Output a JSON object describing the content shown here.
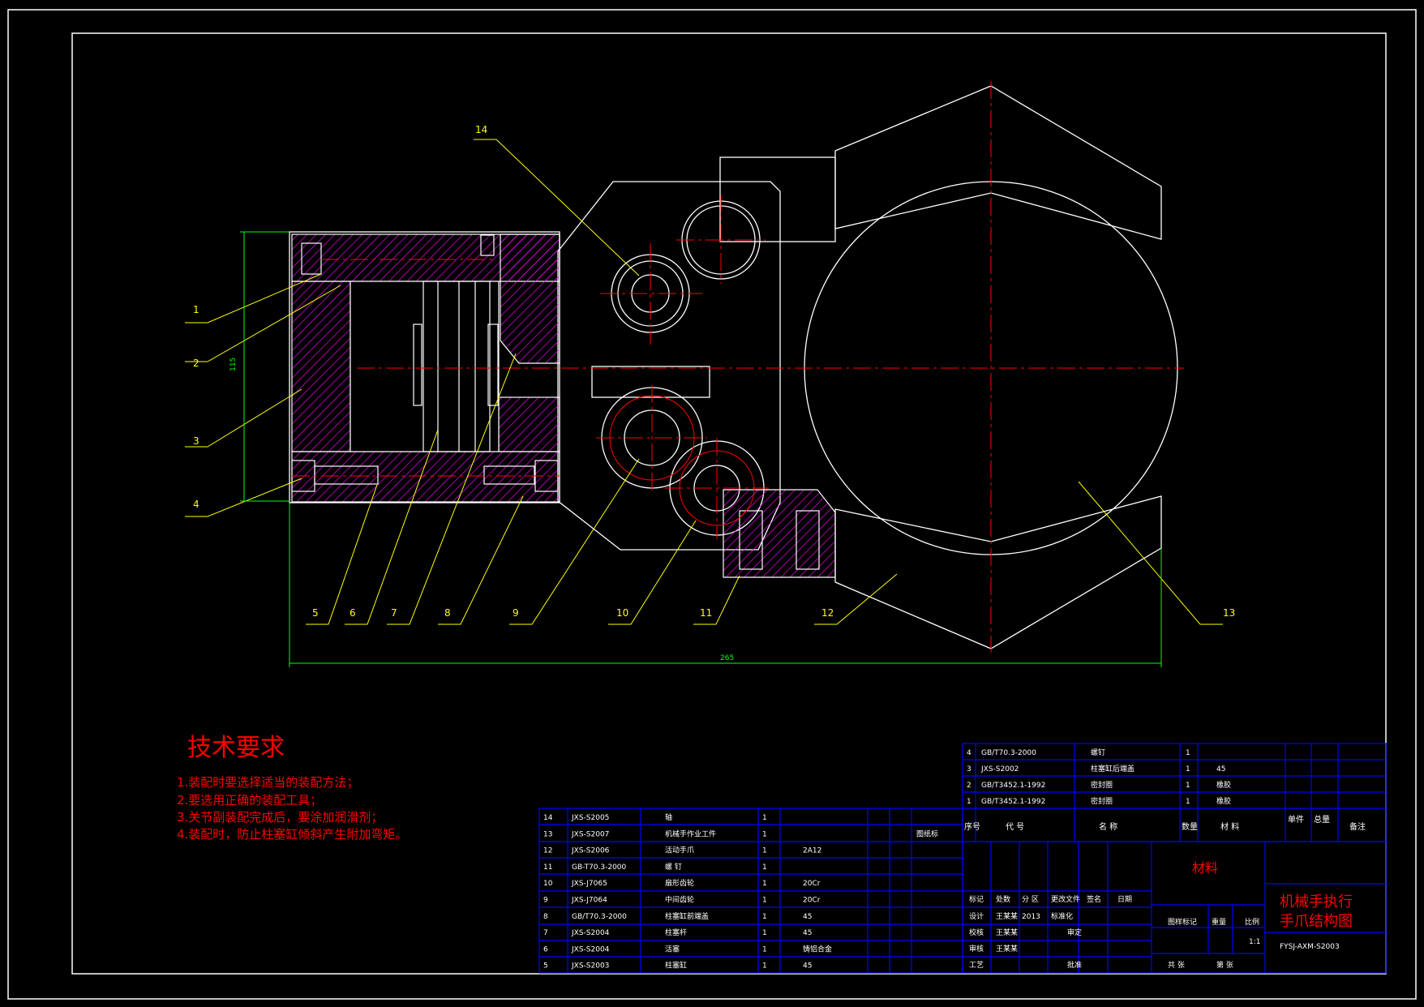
{
  "colors": {
    "background": "#000000",
    "outline": "#ffffff",
    "centerline": "#ff0000",
    "leader": "#ffff00",
    "hatch": "#ff00ff",
    "dimension": "#00ff00",
    "table_line": "#0000ff",
    "title_text": "#ff0000"
  },
  "part_labels": [
    "1",
    "2",
    "3",
    "4",
    "5",
    "6",
    "7",
    "8",
    "9",
    "10",
    "11",
    "12",
    "13",
    "14"
  ],
  "dimensions": {
    "height": "115",
    "width": "265"
  },
  "tech_requirements": {
    "title": "技术要求",
    "items": [
      "1.装配时要选择适当的装配方法；",
      "2.要选用正确的装配工具；",
      "3.关节副装配完成后，要涂加润滑剂；",
      "4.装配时，防止柱塞缸倾斜产生附加弯矩。"
    ]
  },
  "bom_left": [
    {
      "no": "14",
      "code": "JXS-S2005",
      "name": "轴",
      "qty": "1",
      "material": "",
      "note": ""
    },
    {
      "no": "13",
      "code": "JXS-S2007",
      "name": "机械手作业工件",
      "qty": "1",
      "material": "",
      "note": "图纸标"
    },
    {
      "no": "12",
      "code": "JXS-S2006",
      "name": "活动手爪",
      "qty": "1",
      "material": "2A12",
      "note": ""
    },
    {
      "no": "11",
      "code": "GB-T70.3-2000",
      "name": "螺  钉",
      "qty": "1",
      "material": "",
      "note": ""
    },
    {
      "no": "10",
      "code": "JXS-J7065",
      "name": "扇形齿轮",
      "qty": "1",
      "material": "20Cr",
      "note": ""
    },
    {
      "no": "9",
      "code": "JXS-J7064",
      "name": "中间齿轮",
      "qty": "1",
      "material": "20Cr",
      "note": ""
    },
    {
      "no": "8",
      "code": "GB/T70.3-2000",
      "name": "柱塞缸前端盖",
      "qty": "1",
      "material": "45",
      "note": ""
    },
    {
      "no": "7",
      "code": "JXS-S2004",
      "name": "柱塞杆",
      "qty": "1",
      "material": "45",
      "note": ""
    },
    {
      "no": "6",
      "code": "JXS-S2004",
      "name": "活塞",
      "qty": "1",
      "material": "铸铝合金",
      "note": ""
    },
    {
      "no": "5",
      "code": "JXS-S2003",
      "name": "柱塞缸",
      "qty": "1",
      "material": "45",
      "note": ""
    }
  ],
  "bom_right": [
    {
      "no": "4",
      "code": "GB/T70.3-2000",
      "name": "螺钉",
      "qty": "1",
      "material": ""
    },
    {
      "no": "3",
      "code": "JXS-S2002",
      "name": "柱塞缸后端盖",
      "qty": "1",
      "material": "45"
    },
    {
      "no": "2",
      "code": "GB/T3452.1-1992",
      "name": "密封圈",
      "qty": "1",
      "material": "橡胶"
    },
    {
      "no": "1",
      "code": "GB/T3452.1-1992",
      "name": "密封圈",
      "qty": "1",
      "material": "橡胶"
    }
  ],
  "bom_header": {
    "no": "序号",
    "code": "代  号",
    "name": "名  称",
    "qty": "数量",
    "material": "材  料",
    "unit_weight": "单件",
    "total_weight": "总量",
    "remarks": "备注"
  },
  "title_block": {
    "material_label": "材料",
    "title_line1": "机械手执行",
    "title_line2": "手爪结构图",
    "drawing_no": "FYSJ-AXM-S2003",
    "scale": "1:1",
    "row_labels": [
      "标记",
      "处数",
      "分  区",
      "更改文件",
      "签名",
      "日期"
    ],
    "sign_labels": [
      "设计",
      "校核",
      "审核",
      "工艺"
    ],
    "sign_extra": [
      "标准化",
      "审定",
      "批准"
    ],
    "stage_label": "图样标记",
    "weight_label": "重量",
    "scale_label": "比例",
    "sheet_total": "共  张",
    "sheet_no": "第  张",
    "designer": "王某某",
    "date": "2013"
  }
}
